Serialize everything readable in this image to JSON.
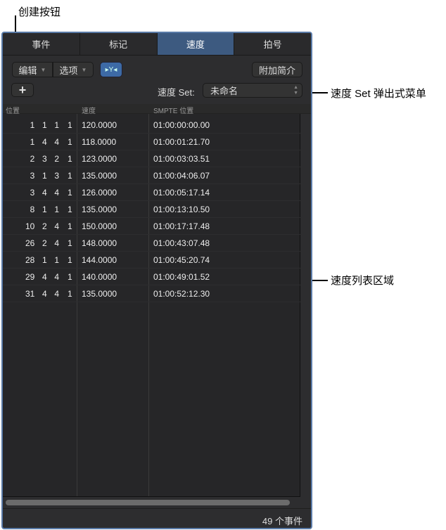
{
  "callouts": {
    "create": "创建按钮",
    "tempo_set": "速度 Set 弹出式菜单",
    "list_area": "速度列表区域"
  },
  "tabs": [
    "事件",
    "标记",
    "速度",
    "拍号"
  ],
  "toolbar": {
    "edit": "编辑",
    "options": "选项",
    "more_info": "附加简介"
  },
  "tempo_set": {
    "label": "速度 Set:",
    "value": "未命名"
  },
  "columns": [
    "位置",
    "速度",
    "SMPTE 位置"
  ],
  "rows": [
    {
      "pos": "1  1  1",
      "beat": "1",
      "tempo": "120.0000",
      "smpte": "01:00:00:00.00"
    },
    {
      "pos": "1  4  4",
      "beat": "1",
      "tempo": "118.0000",
      "smpte": "01:00:01:21.70"
    },
    {
      "pos": "2  3  2",
      "beat": "1",
      "tempo": "123.0000",
      "smpte": "01:00:03:03.51"
    },
    {
      "pos": "3  1  3",
      "beat": "1",
      "tempo": "135.0000",
      "smpte": "01:00:04:06.07"
    },
    {
      "pos": "3  4  4",
      "beat": "1",
      "tempo": "126.0000",
      "smpte": "01:00:05:17.14"
    },
    {
      "pos": "8  1  1",
      "beat": "1",
      "tempo": "135.0000",
      "smpte": "01:00:13:10.50"
    },
    {
      "pos": "10  2  4",
      "beat": "1",
      "tempo": "150.0000",
      "smpte": "01:00:17:17.48"
    },
    {
      "pos": "26  2  4",
      "beat": "1",
      "tempo": "148.0000",
      "smpte": "01:00:43:07.48"
    },
    {
      "pos": "28  1  1",
      "beat": "1",
      "tempo": "144.0000",
      "smpte": "01:00:45:20.74"
    },
    {
      "pos": "29  4  4",
      "beat": "1",
      "tempo": "140.0000",
      "smpte": "01:00:49:01.52"
    },
    {
      "pos": "31  4  4",
      "beat": "1",
      "tempo": "135.0000",
      "smpte": "01:00:52:12.30"
    }
  ],
  "footer": "49 个事件"
}
